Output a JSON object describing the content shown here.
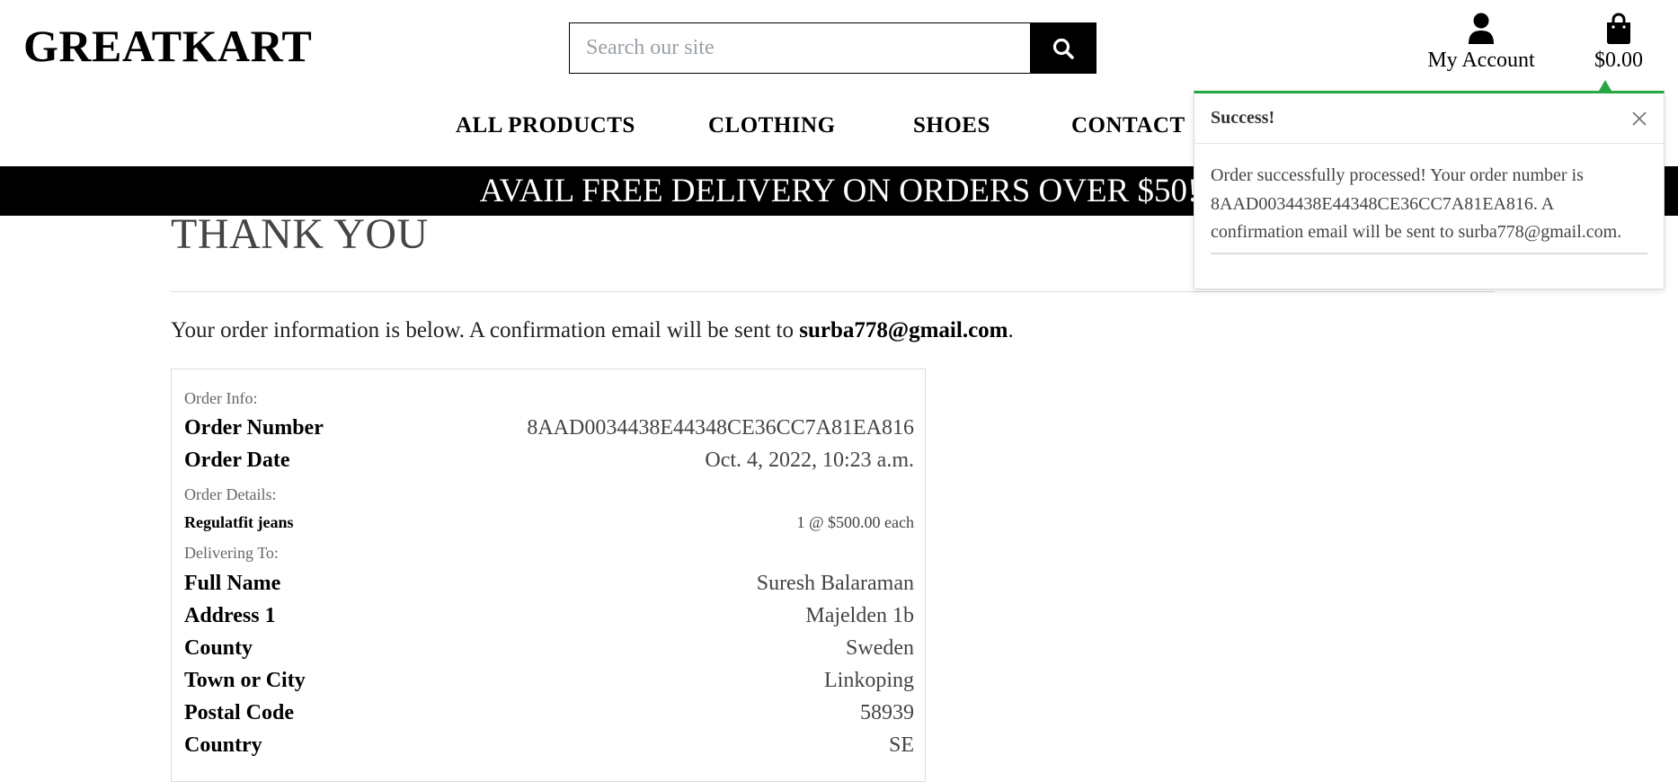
{
  "header": {
    "logo": "GREATKART",
    "search_placeholder": "Search our site",
    "account_label": "My Account",
    "cart_total": "$0.00"
  },
  "nav": {
    "items": [
      "ALL PRODUCTS",
      "CLOTHING",
      "SHOES",
      "CONTACT"
    ]
  },
  "banner": {
    "text": "AVAIL FREE DELIVERY ON ORDERS OVER $50!"
  },
  "main": {
    "title": "THANK YOU",
    "intro_prefix": "Your order information is below. A confirmation email will be sent to ",
    "intro_email": "surba778@gmail.com",
    "intro_suffix": "."
  },
  "order": {
    "order_info_label": "Order Info:",
    "order_number_label": "Order Number",
    "order_number": "8AAD0034438E44348CE36CC7A81EA816",
    "order_date_label": "Order Date",
    "order_date": "Oct. 4, 2022, 10:23 a.m.",
    "order_details_label": "Order Details:",
    "item_name": "Regulatfit jeans",
    "item_qty_price": "1 @ $500.00 each",
    "delivering_label": "Delivering To:",
    "full_name_label": "Full Name",
    "full_name": "Suresh Balaraman",
    "address1_label": "Address 1",
    "address1": "Majelden 1b",
    "county_label": "County",
    "county": "Sweden",
    "town_label": "Town or City",
    "town": "Linkoping",
    "postal_label": "Postal Code",
    "postal": "58939",
    "country_label": "Country",
    "country": "SE"
  },
  "toast": {
    "title": "Success!",
    "message": "Order successfully processed! Your order number is 8AAD0034438E44348CE36CC7A81EA816. A confirmation email will be sent to surba778@gmail.com.",
    "accent_color": "#28a745"
  },
  "icons": {
    "search": "search-icon",
    "account": "user-icon",
    "cart": "shopping-bag-icon",
    "close": "close-icon"
  }
}
